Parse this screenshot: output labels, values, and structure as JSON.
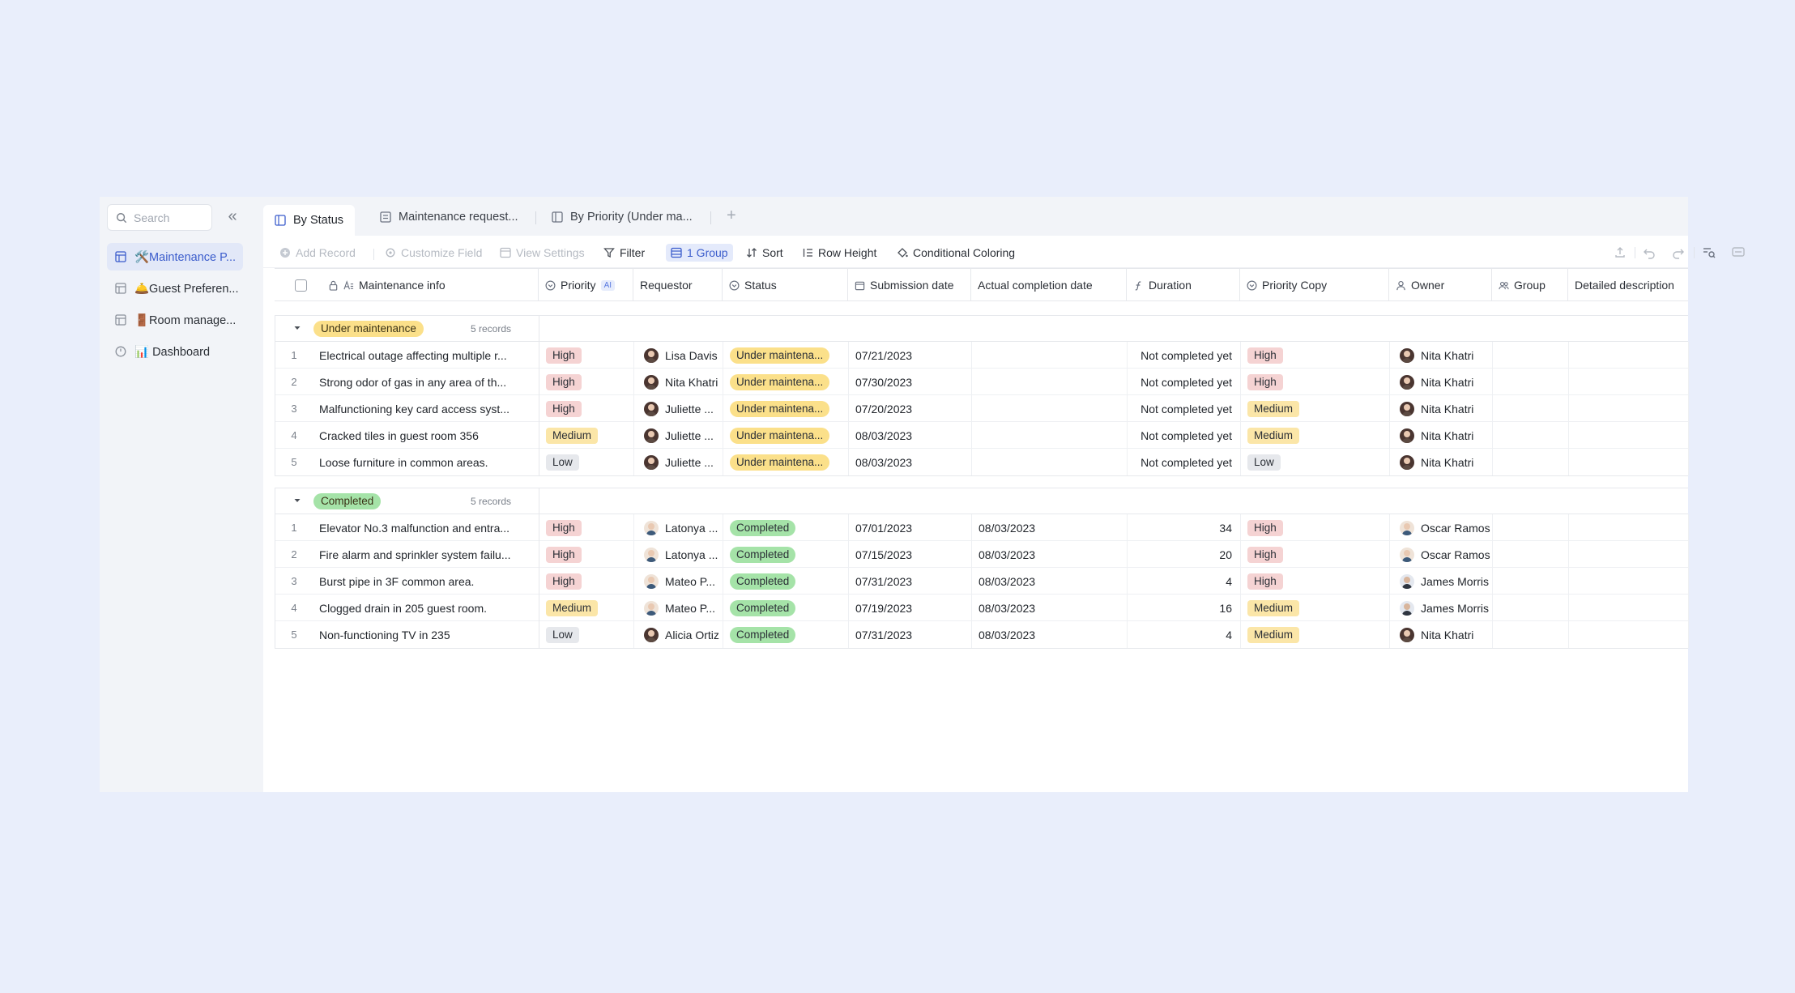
{
  "sidebar": {
    "search_placeholder": "Search",
    "items": [
      {
        "label": "🛠️Maintenance P...",
        "active": true
      },
      {
        "label": "🛎️Guest Preferen...",
        "active": false
      },
      {
        "label": "🚪Room manage...",
        "active": false
      },
      {
        "label": "📊 Dashboard",
        "active": false
      }
    ]
  },
  "tabs": [
    {
      "label": "By Status",
      "active": true
    },
    {
      "label": "Maintenance request...",
      "active": false
    },
    {
      "label": "By Priority (Under ma...",
      "active": false
    }
  ],
  "toolbar": {
    "add_record": "Add Record",
    "customize_field": "Customize Field",
    "view_settings": "View Settings",
    "filter": "Filter",
    "group": "1 Group",
    "sort": "Sort",
    "row_height": "Row Height",
    "conditional_coloring": "Conditional Coloring"
  },
  "columns": {
    "maintenance_info": "Maintenance info",
    "priority": "Priority",
    "ai_badge": "AI",
    "requestor": "Requestor",
    "status": "Status",
    "submission_date": "Submission date",
    "actual_completion_date": "Actual completion date",
    "duration": "Duration",
    "priority_copy": "Priority Copy",
    "owner": "Owner",
    "group": "Group",
    "detailed_description": "Detailed description"
  },
  "colors": {
    "High": "#f5d3d3",
    "Medium": "#fbe6a8",
    "Low": "#e6e8ec",
    "Under maintenance": "#fbe08a",
    "Completed": "#a5e3a8",
    "accent": "#3b5ccc"
  },
  "groups": [
    {
      "label": "Under maintenance",
      "records_label": "5 records",
      "rows": [
        {
          "num": "1",
          "info": "Electrical outage affecting multiple r...",
          "priority": "High",
          "requestor": "Lisa Davis",
          "status": "Under maintena...",
          "submission": "07/21/2023",
          "completion": "",
          "duration": "Not completed yet",
          "priority_copy": "High",
          "owner": "Nita Khatri",
          "av": "f",
          "oav": "f"
        },
        {
          "num": "2",
          "info": "Strong odor of gas in any area of th...",
          "priority": "High",
          "requestor": "Nita Khatri",
          "status": "Under maintena...",
          "submission": "07/30/2023",
          "completion": "",
          "duration": "Not completed yet",
          "priority_copy": "High",
          "owner": "Nita Khatri",
          "av": "f",
          "oav": "f"
        },
        {
          "num": "3",
          "info": "Malfunctioning key card access syst...",
          "priority": "High",
          "requestor": "Juliette ...",
          "status": "Under maintena...",
          "submission": "07/20/2023",
          "completion": "",
          "duration": "Not completed yet",
          "priority_copy": "Medium",
          "owner": "Nita Khatri",
          "av": "f",
          "oav": "f"
        },
        {
          "num": "4",
          "info": "Cracked tiles in guest room 356",
          "priority": "Medium",
          "requestor": "Juliette ...",
          "status": "Under maintena...",
          "submission": "08/03/2023",
          "completion": "",
          "duration": "Not completed yet",
          "priority_copy": "Medium",
          "owner": "Nita Khatri",
          "av": "f",
          "oav": "f"
        },
        {
          "num": "5",
          "info": "Loose furniture in common areas.",
          "priority": "Low",
          "requestor": "Juliette ...",
          "status": "Under maintena...",
          "submission": "08/03/2023",
          "completion": "",
          "duration": "Not completed yet",
          "priority_copy": "Low",
          "owner": "Nita Khatri",
          "av": "f",
          "oav": "f"
        }
      ]
    },
    {
      "label": "Completed",
      "records_label": "5 records",
      "rows": [
        {
          "num": "1",
          "info": "Elevator No.3 malfunction and entra...",
          "priority": "High",
          "requestor": "Latonya ...",
          "status": "Completed",
          "submission": "07/01/2023",
          "completion": "08/03/2023",
          "duration": "34",
          "priority_copy": "High",
          "owner": "Oscar Ramos",
          "av": "m",
          "oav": "m"
        },
        {
          "num": "2",
          "info": "Fire alarm and sprinkler system failu...",
          "priority": "High",
          "requestor": "Latonya ...",
          "status": "Completed",
          "submission": "07/15/2023",
          "completion": "08/03/2023",
          "duration": "20",
          "priority_copy": "High",
          "owner": "Oscar Ramos",
          "av": "m",
          "oav": "m"
        },
        {
          "num": "3",
          "info": "Burst pipe in 3F common area.",
          "priority": "High",
          "requestor": "Mateo P...",
          "status": "Completed",
          "submission": "07/31/2023",
          "completion": "08/03/2023",
          "duration": "4",
          "priority_copy": "High",
          "owner": "James Morris",
          "av": "m",
          "oav": "m2"
        },
        {
          "num": "4",
          "info": "Clogged drain in 205 guest room.",
          "priority": "Medium",
          "requestor": "Mateo P...",
          "status": "Completed",
          "submission": "07/19/2023",
          "completion": "08/03/2023",
          "duration": "16",
          "priority_copy": "Medium",
          "owner": "James Morris",
          "av": "m",
          "oav": "m2"
        },
        {
          "num": "5",
          "info": "Non-functioning TV in 235",
          "priority": "Low",
          "requestor": "Alicia Ortiz",
          "status": "Completed",
          "submission": "07/31/2023",
          "completion": "08/03/2023",
          "duration": "4",
          "priority_copy": "Medium",
          "owner": "Nita Khatri",
          "av": "f",
          "oav": "f"
        }
      ]
    }
  ]
}
